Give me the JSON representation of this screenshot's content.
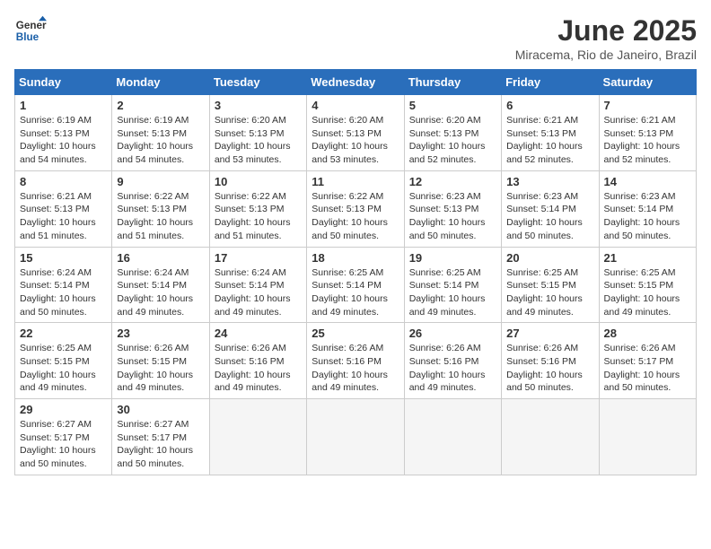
{
  "logo": {
    "line1": "General",
    "line2": "Blue"
  },
  "title": "June 2025",
  "subtitle": "Miracema, Rio de Janeiro, Brazil",
  "weekdays": [
    "Sunday",
    "Monday",
    "Tuesday",
    "Wednesday",
    "Thursday",
    "Friday",
    "Saturday"
  ],
  "weeks": [
    [
      {
        "day": "1",
        "sunrise": "6:19 AM",
        "sunset": "5:13 PM",
        "daylight": "10 hours and 54 minutes."
      },
      {
        "day": "2",
        "sunrise": "6:19 AM",
        "sunset": "5:13 PM",
        "daylight": "10 hours and 54 minutes."
      },
      {
        "day": "3",
        "sunrise": "6:20 AM",
        "sunset": "5:13 PM",
        "daylight": "10 hours and 53 minutes."
      },
      {
        "day": "4",
        "sunrise": "6:20 AM",
        "sunset": "5:13 PM",
        "daylight": "10 hours and 53 minutes."
      },
      {
        "day": "5",
        "sunrise": "6:20 AM",
        "sunset": "5:13 PM",
        "daylight": "10 hours and 52 minutes."
      },
      {
        "day": "6",
        "sunrise": "6:21 AM",
        "sunset": "5:13 PM",
        "daylight": "10 hours and 52 minutes."
      },
      {
        "day": "7",
        "sunrise": "6:21 AM",
        "sunset": "5:13 PM",
        "daylight": "10 hours and 52 minutes."
      }
    ],
    [
      {
        "day": "8",
        "sunrise": "6:21 AM",
        "sunset": "5:13 PM",
        "daylight": "10 hours and 51 minutes."
      },
      {
        "day": "9",
        "sunrise": "6:22 AM",
        "sunset": "5:13 PM",
        "daylight": "10 hours and 51 minutes."
      },
      {
        "day": "10",
        "sunrise": "6:22 AM",
        "sunset": "5:13 PM",
        "daylight": "10 hours and 51 minutes."
      },
      {
        "day": "11",
        "sunrise": "6:22 AM",
        "sunset": "5:13 PM",
        "daylight": "10 hours and 50 minutes."
      },
      {
        "day": "12",
        "sunrise": "6:23 AM",
        "sunset": "5:13 PM",
        "daylight": "10 hours and 50 minutes."
      },
      {
        "day": "13",
        "sunrise": "6:23 AM",
        "sunset": "5:14 PM",
        "daylight": "10 hours and 50 minutes."
      },
      {
        "day": "14",
        "sunrise": "6:23 AM",
        "sunset": "5:14 PM",
        "daylight": "10 hours and 50 minutes."
      }
    ],
    [
      {
        "day": "15",
        "sunrise": "6:24 AM",
        "sunset": "5:14 PM",
        "daylight": "10 hours and 50 minutes."
      },
      {
        "day": "16",
        "sunrise": "6:24 AM",
        "sunset": "5:14 PM",
        "daylight": "10 hours and 49 minutes."
      },
      {
        "day": "17",
        "sunrise": "6:24 AM",
        "sunset": "5:14 PM",
        "daylight": "10 hours and 49 minutes."
      },
      {
        "day": "18",
        "sunrise": "6:25 AM",
        "sunset": "5:14 PM",
        "daylight": "10 hours and 49 minutes."
      },
      {
        "day": "19",
        "sunrise": "6:25 AM",
        "sunset": "5:14 PM",
        "daylight": "10 hours and 49 minutes."
      },
      {
        "day": "20",
        "sunrise": "6:25 AM",
        "sunset": "5:15 PM",
        "daylight": "10 hours and 49 minutes."
      },
      {
        "day": "21",
        "sunrise": "6:25 AM",
        "sunset": "5:15 PM",
        "daylight": "10 hours and 49 minutes."
      }
    ],
    [
      {
        "day": "22",
        "sunrise": "6:25 AM",
        "sunset": "5:15 PM",
        "daylight": "10 hours and 49 minutes."
      },
      {
        "day": "23",
        "sunrise": "6:26 AM",
        "sunset": "5:15 PM",
        "daylight": "10 hours and 49 minutes."
      },
      {
        "day": "24",
        "sunrise": "6:26 AM",
        "sunset": "5:16 PM",
        "daylight": "10 hours and 49 minutes."
      },
      {
        "day": "25",
        "sunrise": "6:26 AM",
        "sunset": "5:16 PM",
        "daylight": "10 hours and 49 minutes."
      },
      {
        "day": "26",
        "sunrise": "6:26 AM",
        "sunset": "5:16 PM",
        "daylight": "10 hours and 49 minutes."
      },
      {
        "day": "27",
        "sunrise": "6:26 AM",
        "sunset": "5:16 PM",
        "daylight": "10 hours and 50 minutes."
      },
      {
        "day": "28",
        "sunrise": "6:26 AM",
        "sunset": "5:17 PM",
        "daylight": "10 hours and 50 minutes."
      }
    ],
    [
      {
        "day": "29",
        "sunrise": "6:27 AM",
        "sunset": "5:17 PM",
        "daylight": "10 hours and 50 minutes."
      },
      {
        "day": "30",
        "sunrise": "6:27 AM",
        "sunset": "5:17 PM",
        "daylight": "10 hours and 50 minutes."
      },
      null,
      null,
      null,
      null,
      null
    ]
  ]
}
